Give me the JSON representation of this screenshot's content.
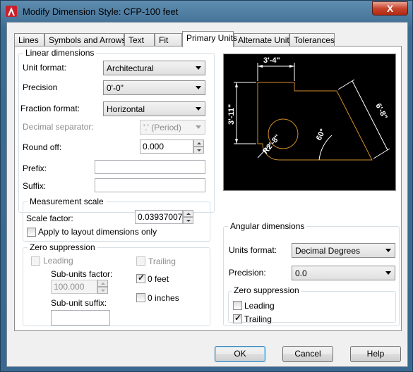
{
  "window": {
    "title": "Modify Dimension Style: CFP-100 feet",
    "close_label": "X"
  },
  "tabs": [
    "Lines",
    "Symbols and Arrows",
    "Text",
    "Fit",
    "Primary Units",
    "Alternate Units",
    "Tolerances"
  ],
  "active_tab": "Primary Units",
  "linear": {
    "group_title": "Linear dimensions",
    "unit_format_label": "Unit format:",
    "unit_format_value": "Architectural",
    "precision_label": "Precision",
    "precision_value": "0'-0\"",
    "fraction_format_label": "Fraction format:",
    "fraction_format_value": "Horizontal",
    "decimal_separator_label": "Decimal separator:",
    "decimal_separator_value": "'.' (Period)",
    "round_off_label": "Round off:",
    "round_off_value": "0.000",
    "prefix_label": "Prefix:",
    "prefix_value": "",
    "suffix_label": "Suffix:",
    "suffix_value": ""
  },
  "measurement_scale": {
    "group_title": "Measurement scale",
    "scale_factor_label": "Scale factor:",
    "scale_factor_value": "0.0393700787",
    "apply_layout_label": "Apply to layout dimensions only",
    "apply_layout_checked": false
  },
  "zero_suppression_linear": {
    "group_title": "Zero suppression",
    "leading_label": "Leading",
    "trailing_label": "Trailing",
    "subunits_factor_label": "Sub-units factor:",
    "subunits_factor_value": "100.000",
    "subunit_suffix_label": "Sub-unit suffix:",
    "subunit_suffix_value": "",
    "zero_feet_label": "0 feet",
    "zero_feet_checked": true,
    "zero_inches_label": "0 inches",
    "zero_inches_checked": false
  },
  "angular": {
    "group_title": "Angular dimensions",
    "units_format_label": "Units format:",
    "units_format_value": "Decimal Degrees",
    "precision_label": "Precision:",
    "precision_value": "0.0",
    "zero_group_title": "Zero suppression",
    "leading_label": "Leading",
    "leading_checked": false,
    "trailing_label": "Trailing",
    "trailing_checked": true
  },
  "preview": {
    "dim_top": "3'-4\"",
    "dim_left": "3'-11\"",
    "dim_right": "6'-8\"",
    "dim_radius": "R2'-8\"",
    "dim_angle": "60°"
  },
  "buttons": {
    "ok": "OK",
    "cancel": "Cancel",
    "help": "Help"
  },
  "colors": {
    "preview_bg": "#000000",
    "dim_lines": "#ffffff",
    "geometry": "#d08c2a"
  }
}
